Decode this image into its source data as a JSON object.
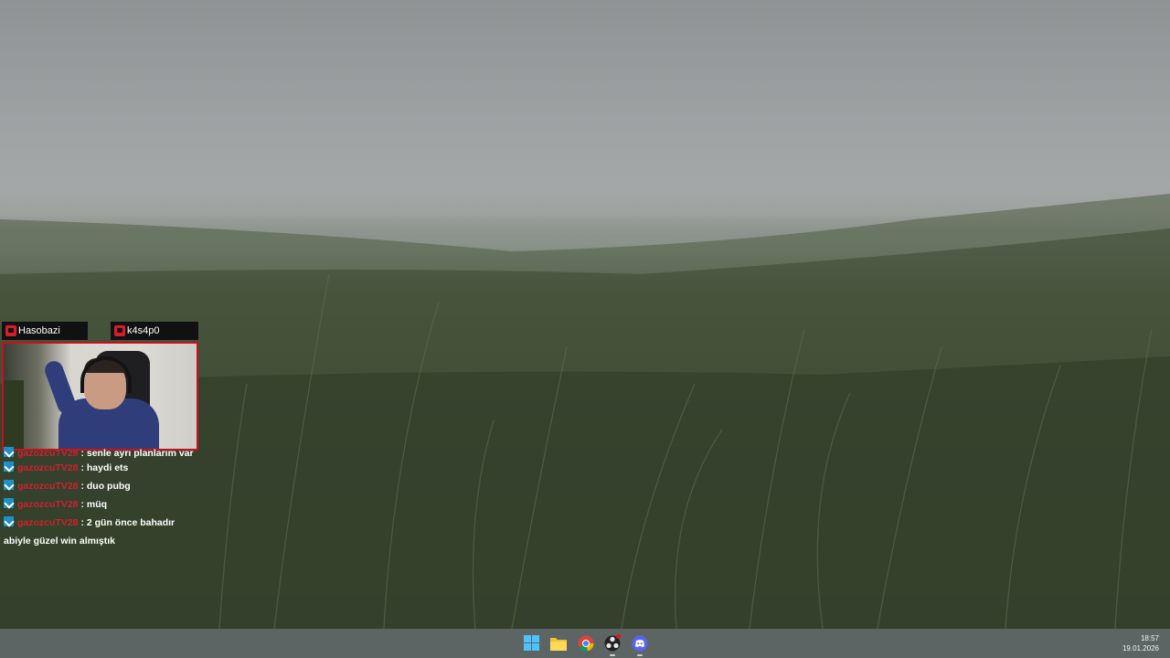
{
  "overlay": {
    "cam_tag_left": "Hasobazi",
    "cam_tag_right": "k4s4p0",
    "accent_color": "#c8101e"
  },
  "chat": {
    "messages": [
      {
        "user": "gazozcuTV28",
        "text": ": senle ayrı planlarım var"
      },
      {
        "user": "gazozcuTV28",
        "text": ": haydi ets"
      },
      {
        "user": "gazozcuTV28",
        "text": ": duo pubg"
      },
      {
        "user": "gazozcuTV28",
        "text": ": müq"
      },
      {
        "user": "gazozcuTV28",
        "text": ": 2 gün önce bahadır"
      }
    ],
    "wrapped_line": "abiyle güzel win almıştık",
    "platform_icon": "twitch-icon"
  },
  "taskbar": {
    "icons": [
      "windows-start-icon",
      "file-explorer-icon",
      "chrome-icon",
      "obs-icon",
      "discord-icon"
    ],
    "time": "18:57",
    "date": "19.01.2026"
  }
}
